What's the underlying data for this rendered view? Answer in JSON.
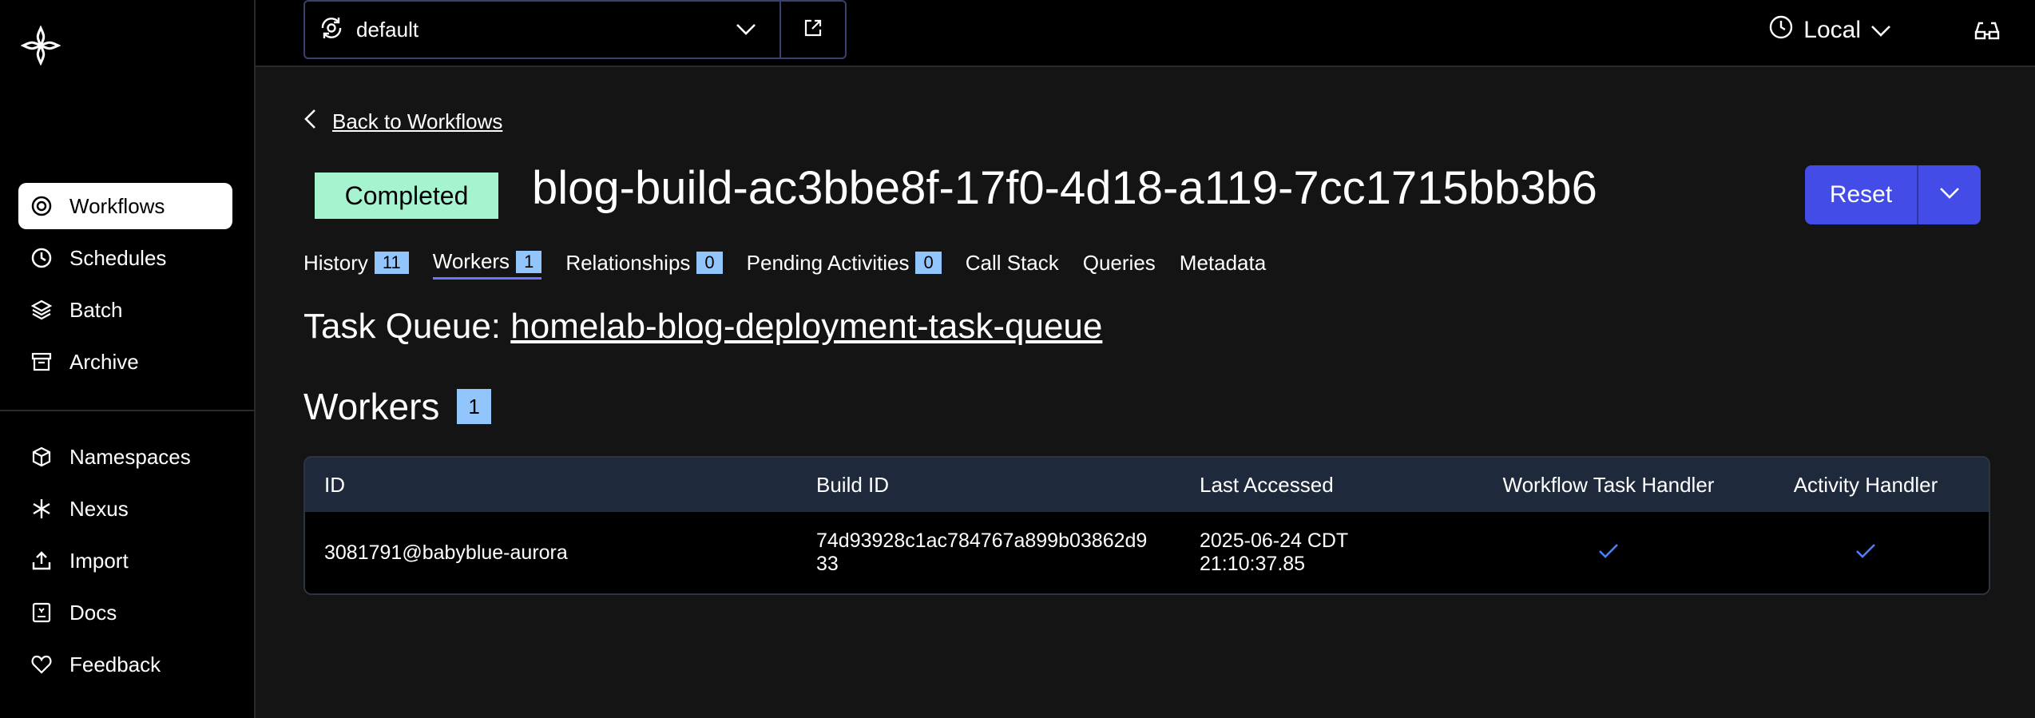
{
  "sidebar": {
    "items": [
      {
        "label": "Workflows",
        "icon": "workflows-icon"
      },
      {
        "label": "Schedules",
        "icon": "schedules-icon"
      },
      {
        "label": "Batch",
        "icon": "batch-icon"
      },
      {
        "label": "Archive",
        "icon": "archive-icon"
      }
    ],
    "bottom_items": [
      {
        "label": "Namespaces",
        "icon": "namespaces-icon"
      },
      {
        "label": "Nexus",
        "icon": "nexus-icon"
      },
      {
        "label": "Import",
        "icon": "import-icon"
      },
      {
        "label": "Docs",
        "icon": "docs-icon"
      },
      {
        "label": "Feedback",
        "icon": "feedback-icon"
      }
    ]
  },
  "topbar": {
    "namespace": "default",
    "timezone": "Local"
  },
  "workflow": {
    "back_label": "Back to Workflows",
    "status": "Completed",
    "title": "blog-build-ac3bbe8f-17f0-4d18-a119-7cc1715bb3b6",
    "reset_label": "Reset",
    "tabs": [
      {
        "label": "History",
        "count": "11"
      },
      {
        "label": "Workers",
        "count": "1"
      },
      {
        "label": "Relationships",
        "count": "0"
      },
      {
        "label": "Pending Activities",
        "count": "0"
      },
      {
        "label": "Call Stack"
      },
      {
        "label": "Queries"
      },
      {
        "label": "Metadata"
      }
    ],
    "task_queue_label": "Task Queue:",
    "task_queue": "homelab-blog-deployment-task-queue",
    "workers_heading": "Workers",
    "workers_count": "1"
  },
  "table": {
    "headers": [
      "ID",
      "Build ID",
      "Last Accessed",
      "Workflow Task Handler",
      "Activity Handler"
    ],
    "rows": [
      {
        "id": "3081791@babyblue-aurora",
        "build_id_line1": "74d93928c1ac784767a899b03862d9",
        "build_id_line2": "33",
        "last_accessed_line1": "2025-06-24 CDT",
        "last_accessed_line2": "21:10:37.85",
        "workflow_task_handler": true,
        "activity_handler": true
      }
    ]
  },
  "colors": {
    "accent": "#444ce7",
    "status_completed": "#a6f3cf",
    "count_badge": "#93c5fd",
    "check": "#4f7dff"
  }
}
